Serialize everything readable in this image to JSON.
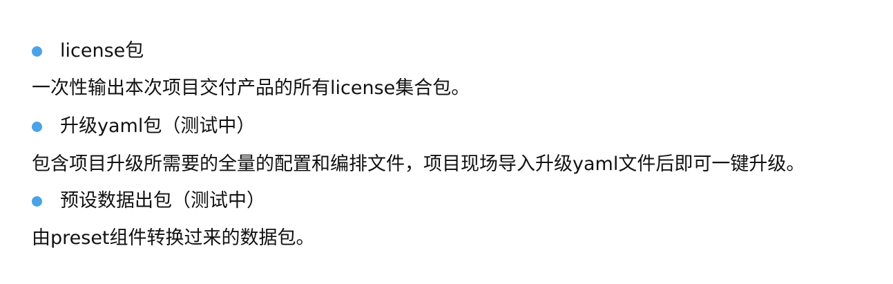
{
  "colors": {
    "bullet": "#4aa3e6",
    "text": "#111111",
    "background": "#ffffff"
  },
  "items": [
    {
      "title": "license包",
      "description": "一次性输出本次项目交付产品的所有license集合包。"
    },
    {
      "title": "升级yaml包（测试中）",
      "description": "包含项目升级所需要的全量的配置和编排文件，项目现场导入升级yaml文件后即可一键升级。"
    },
    {
      "title": "预设数据出包（测试中）",
      "description": "由preset组件转换过来的数据包。"
    }
  ]
}
